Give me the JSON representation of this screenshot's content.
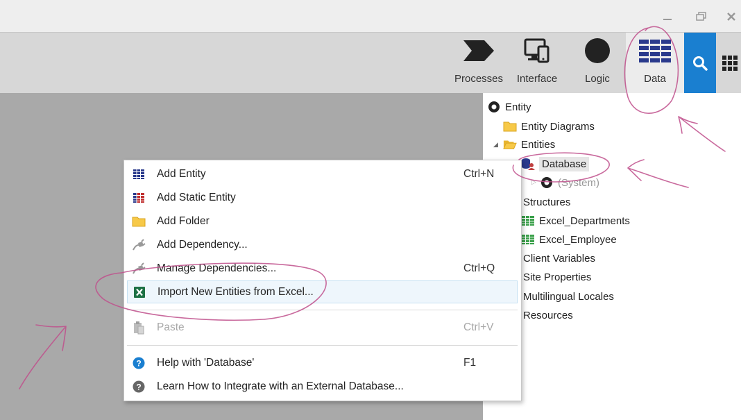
{
  "window": {
    "minimize_glyph": "—",
    "restore_glyph": "❐",
    "close_glyph": "✕"
  },
  "toolbar": {
    "tabs": [
      {
        "label": "Processes",
        "icon": "processes-chevron-icon"
      },
      {
        "label": "Interface",
        "icon": "interface-devices-icon"
      },
      {
        "label": "Logic",
        "icon": "logic-circle-icon"
      },
      {
        "label": "Data",
        "icon": "data-grid-icon",
        "active": true
      }
    ],
    "search_icon": "search-icon",
    "apps_icon": "apps-grid-icon"
  },
  "tree": {
    "items": [
      {
        "label": "Entity",
        "icon": "entity-module-icon"
      },
      {
        "label": "Entity Diagrams",
        "icon": "folder-icon"
      },
      {
        "label": "Entities",
        "icon": "folder-open-icon"
      },
      {
        "label": "Database",
        "icon": "database-icon"
      },
      {
        "label": "(System)",
        "icon": "system-module-icon"
      },
      {
        "label": "Structures"
      },
      {
        "label": "Excel_Departments",
        "icon": "structure-icon"
      },
      {
        "label": "Excel_Employee",
        "icon": "structure-icon"
      },
      {
        "label": "Client Variables"
      },
      {
        "label": "Site Properties"
      },
      {
        "label": "Multilingual Locales"
      },
      {
        "label": "Resources"
      }
    ]
  },
  "context_menu": {
    "items": [
      {
        "label": "Add Entity",
        "shortcut": "Ctrl+N",
        "icon": "entity-table-icon"
      },
      {
        "label": "Add Static Entity",
        "shortcut": "",
        "icon": "static-entity-icon"
      },
      {
        "label": "Add Folder",
        "shortcut": "",
        "icon": "folder-icon"
      },
      {
        "label": "Add Dependency...",
        "shortcut": "",
        "icon": "plug-icon"
      },
      {
        "label": "Manage Dependencies...",
        "shortcut": "Ctrl+Q",
        "icon": "plug-icon"
      },
      {
        "label": "Import New Entities from Excel...",
        "shortcut": "",
        "icon": "excel-icon"
      },
      {
        "label": "Paste",
        "shortcut": "Ctrl+V",
        "icon": "paste-icon",
        "disabled": true
      },
      {
        "label": "Help with 'Database'",
        "shortcut": "F1",
        "icon": "help-icon"
      },
      {
        "label": "Learn How to Integrate with an External Database...",
        "shortcut": "",
        "icon": "help-gray-icon"
      }
    ]
  },
  "colors": {
    "accent_blue": "#1a7fd0",
    "canvas_gray": "#a9a9a9",
    "annotation_pink": "#c0508c",
    "excel_green": "#1e7145"
  }
}
